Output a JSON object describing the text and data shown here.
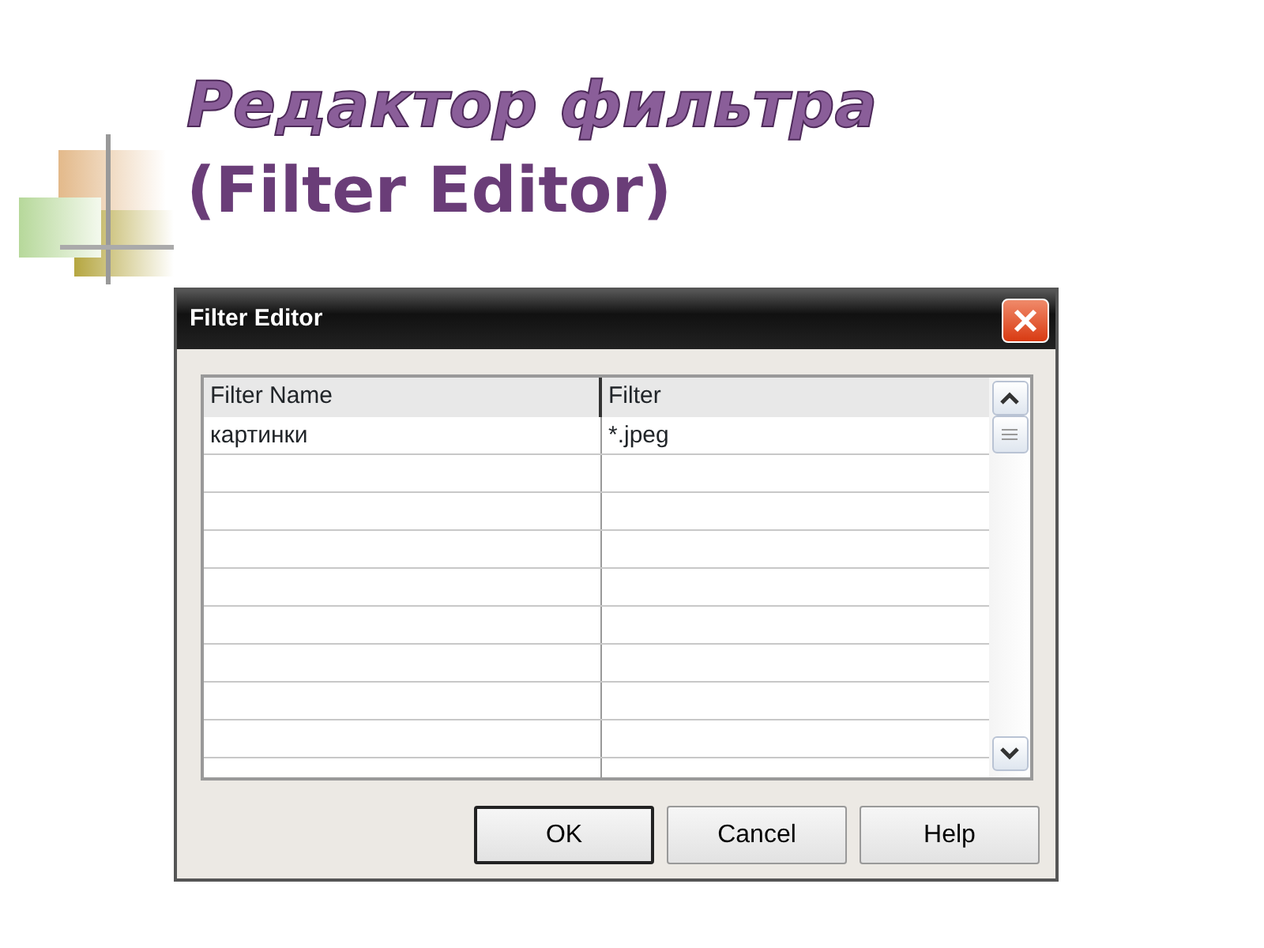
{
  "slide": {
    "title_lines": [
      "Редактор фильтра",
      "(Filter Editor)"
    ]
  },
  "window": {
    "title": "Filter Editor"
  },
  "table": {
    "columns": [
      "Filter Name",
      "Filter"
    ],
    "rows": [
      [
        "картинки",
        "*.jpeg"
      ]
    ]
  },
  "buttons": [
    {
      "label": "OK",
      "default": true
    },
    {
      "label": "Cancel",
      "default": false
    },
    {
      "label": "Help",
      "default": false
    }
  ]
}
